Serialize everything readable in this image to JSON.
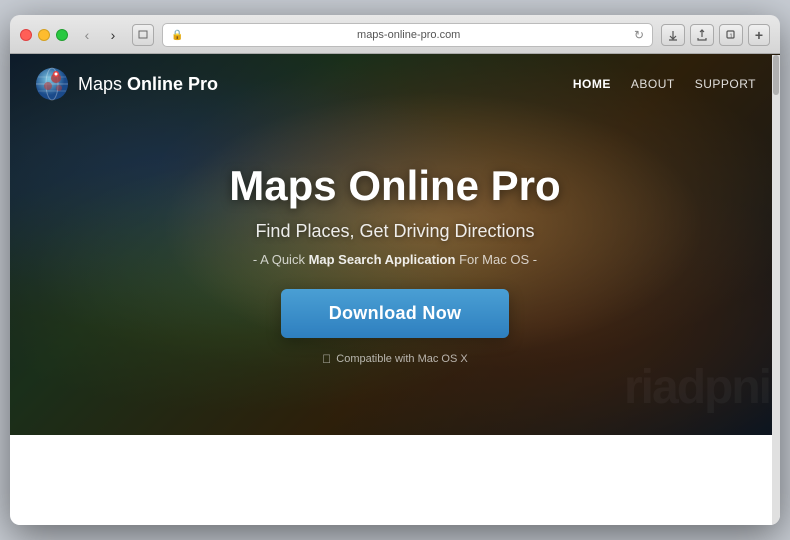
{
  "browser": {
    "address": "maps-online-pro.com",
    "back_btn": "‹",
    "forward_btn": "›"
  },
  "site": {
    "logo": {
      "text_normal": "Maps ",
      "text_bold": "Online Pro"
    },
    "nav": {
      "items": [
        {
          "label": "HOME",
          "active": true
        },
        {
          "label": "ABOUT",
          "active": false
        },
        {
          "label": "SUPPORT",
          "active": false
        }
      ]
    },
    "hero": {
      "title": "Maps Online Pro",
      "subtitle": "Find Places, Get Driving Directions",
      "description_prefix": "- A Quick ",
      "description_highlight": "Map Search Application",
      "description_suffix": " For Mac OS -",
      "download_btn": "Download Now",
      "compatible_text": "Compatible with Mac OS X"
    }
  },
  "watermark": "riadpni"
}
